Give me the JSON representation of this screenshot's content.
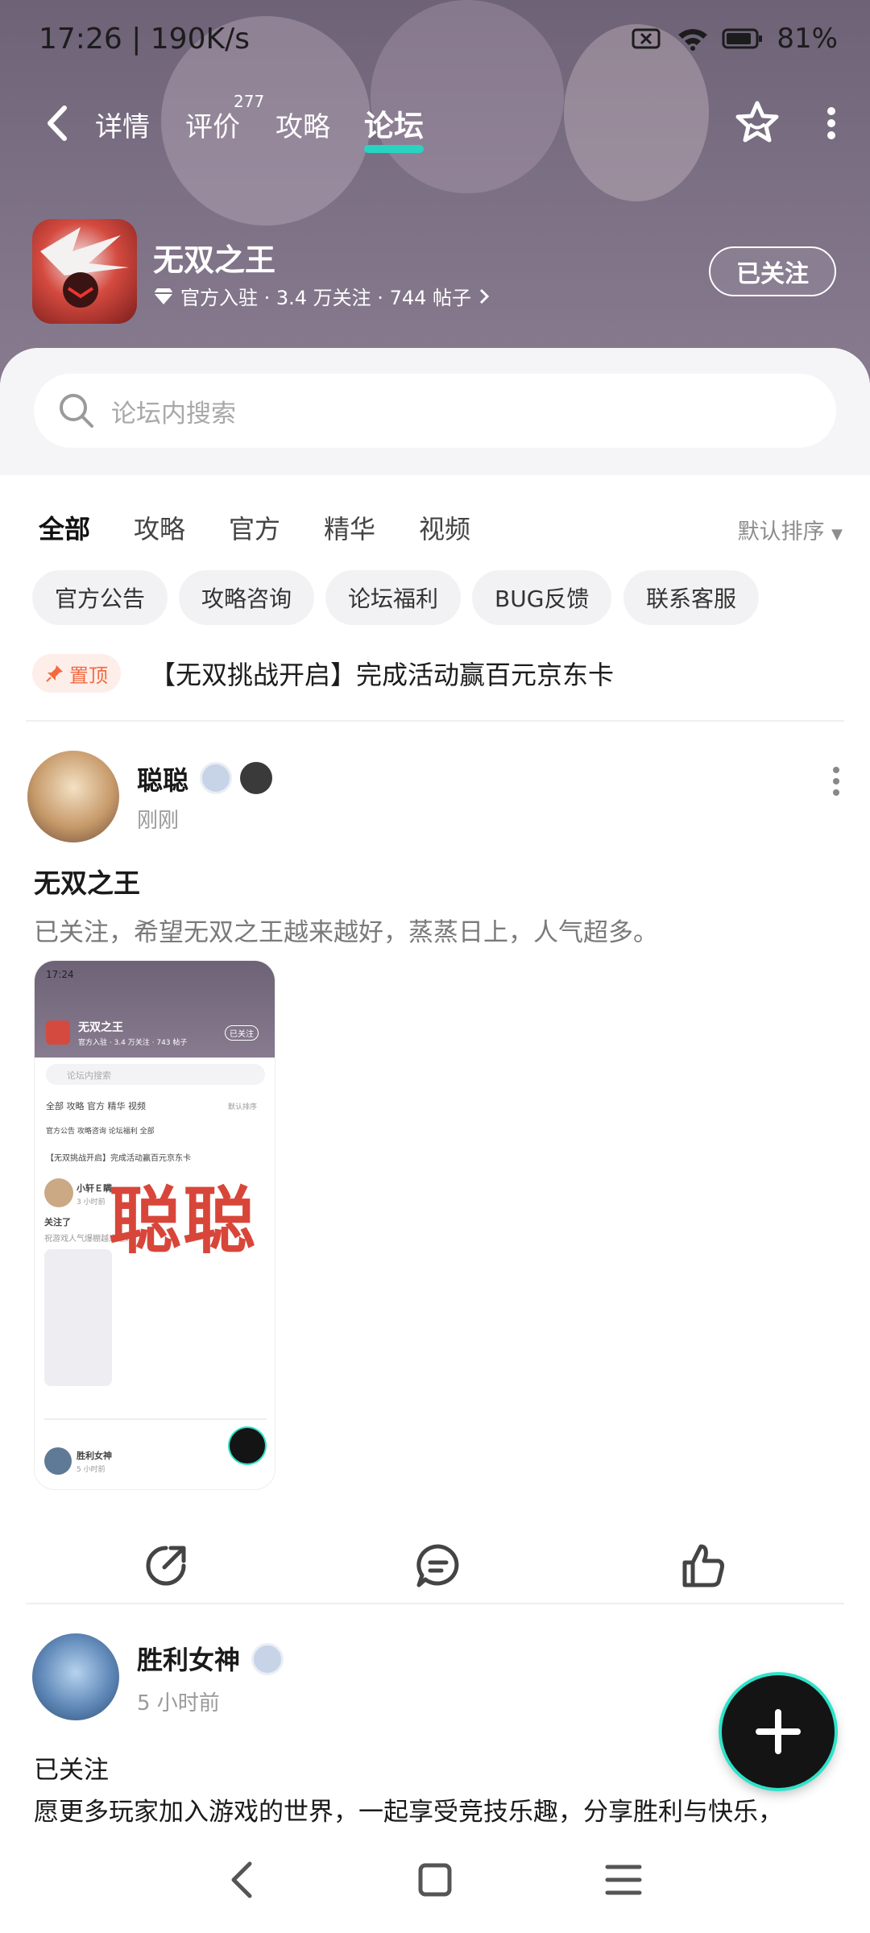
{
  "status": {
    "time_speed": "17:26 | 190K/s",
    "battery": "81%"
  },
  "nav": {
    "tabs": [
      {
        "label": "详情"
      },
      {
        "label": "评价",
        "badge": "277"
      },
      {
        "label": "攻略"
      },
      {
        "label": "论坛"
      }
    ],
    "active_tab": "论坛"
  },
  "app": {
    "name": "无双之王",
    "meta": "官方入驻 · 3.4 万关注 · 744 帖子",
    "follow_label": "已关注"
  },
  "search": {
    "placeholder": "论坛内搜索"
  },
  "category_tabs": [
    "全部",
    "攻略",
    "官方",
    "精华",
    "视频"
  ],
  "sort_label": "默认排序",
  "chips": [
    "官方公告",
    "攻略咨询",
    "论坛福利",
    "BUG反馈",
    "联系客服"
  ],
  "pinned": {
    "tag": "置顶",
    "title": "【无双挑战开启】完成活动赢百元京东卡"
  },
  "posts": [
    {
      "user": "聪聪",
      "time": "刚刚",
      "title": "无双之王",
      "body": "已关注，希望无双之王越来越好，蒸蒸日上，人气超多。",
      "image_watermark": "聪聪",
      "image_texts": {
        "time": "17:24",
        "app_name": "无双之王",
        "follow": "已关注",
        "meta": "官方入驻 · 3.4 万关注 · 743 帖子",
        "search": "论坛内搜索",
        "tabs": "全部   攻略   官方   精华   视频",
        "sort": "默认排序",
        "chips": "官方公告   攻略咨询   论坛福利   全部",
        "pinned": "【无双挑战开启】完成活动赢百元京东卡",
        "user1": "小轩Ｅ瞒",
        "user1_time": "3 小时前",
        "user1_title": "关注了",
        "user1_body": "祝游戏人气爆棚越来越好",
        "user2": "胜利女神",
        "user2_time": "5 小时前"
      }
    },
    {
      "user": "胜利女神",
      "time": "5 小时前",
      "title": "已关注",
      "body": "愿更多玩家加入游戏的世界，一起享受竞技乐趣，分享胜利与快乐，"
    }
  ],
  "colors": {
    "accent": "#29d3c2",
    "pin": "#f46a3f",
    "banner": "#7b6f84"
  }
}
